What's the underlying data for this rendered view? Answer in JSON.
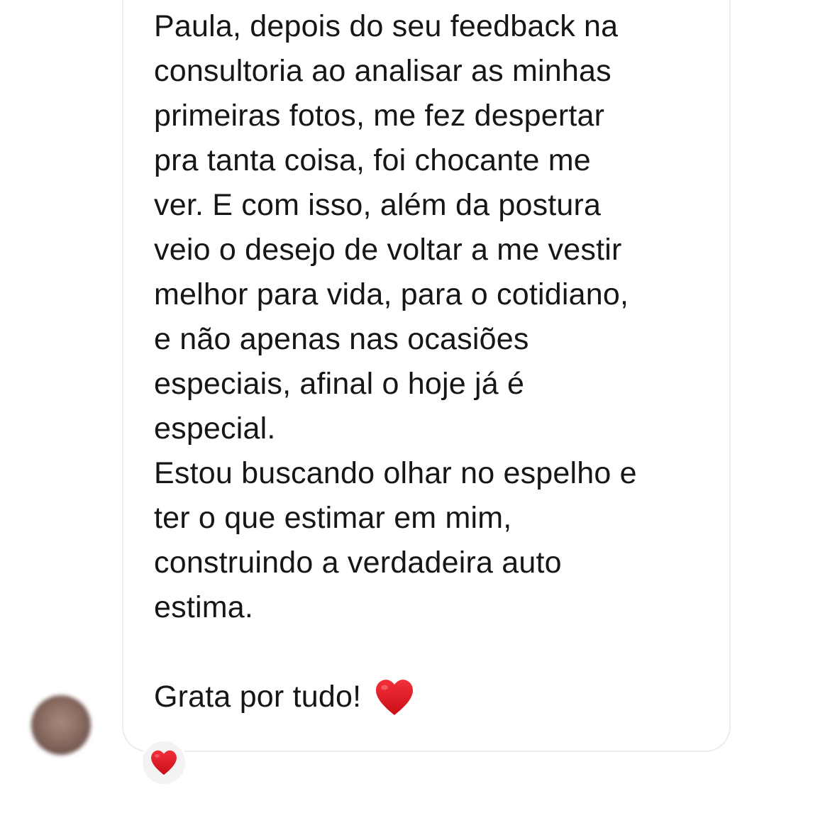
{
  "message": {
    "paragraph_1": "Paula, depois do seu feedback na\nconsultoria ao analisar as minhas\nprimeiras fotos, me fez despertar\npra tanta coisa, foi chocante me\nver.  E com isso, além da postura\nveio o desejo de voltar a me vestir\nmelhor para vida, para o cotidiano,\ne não apenas nas ocasiões\nespeciais, afinal o hoje já é\nespecial.",
    "paragraph_2": "Estou buscando olhar no espelho e\nter o que estimar em mim,\nconstruindo a verdadeira auto\nestima.",
    "closing": "Grata por tudo!",
    "inline_emoji": "heart-icon"
  },
  "reaction": {
    "emoji": "heart-icon"
  },
  "colors": {
    "text": "#161616",
    "bubble_border": "#ececec",
    "heart": "#e0141e"
  }
}
